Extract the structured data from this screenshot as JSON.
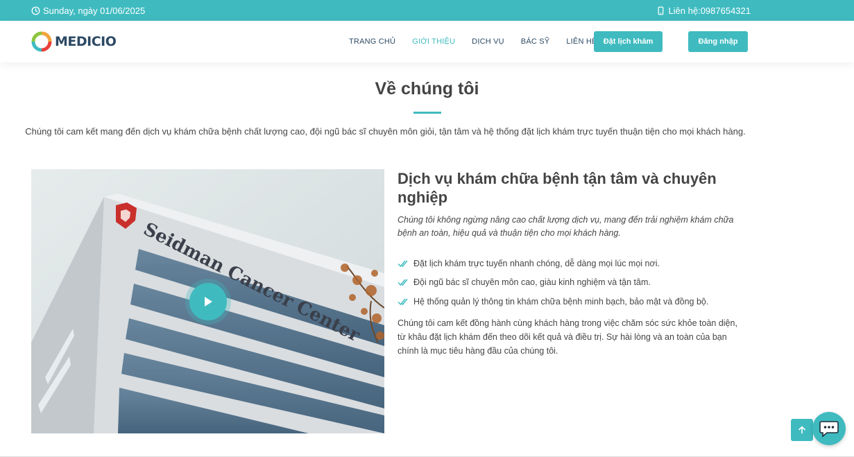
{
  "topbar": {
    "date": "Sunday, ngày 01/06/2025",
    "contact": "Liên hệ:0987654321",
    "date_icon": "clock-icon",
    "contact_icon": "phone-icon"
  },
  "header": {
    "logo_text": "MEDICIO",
    "nav": [
      "TRANG CHỦ",
      "GIỚI THIỆU",
      "DỊCH VỤ",
      "BÁC SỸ",
      "LIÊN HỆ"
    ],
    "active_nav": "GIỚI THIỆU",
    "book_button": "Đặt lịch khám",
    "login_button": "Đăng nhập"
  },
  "about": {
    "title": "Về chúng tôi",
    "intro": "Chúng tôi cam kết mang đến dịch vụ khám chữa bệnh chất lượng cao, đội ngũ bác sĩ chuyên môn giỏi, tận tâm và hệ thống đặt lịch khám trực tuyến thuận tiện cho mọi khách hàng.",
    "heading": "Dịch vụ khám chữa bệnh tận tâm và chuyên nghiệp",
    "lead": "Chúng tôi không ngừng nâng cao chất lượng dịch vụ, mang đến trải nghiệm khám chữa bệnh an toàn, hiệu quả và thuận tiện cho mọi khách hàng.",
    "checklist": [
      "Đặt lịch khám trực tuyến nhanh chóng, dễ dàng mọi lúc mọi nơi.",
      "Đội ngũ bác sĩ chuyên môn cao, giàu kinh nghiệm và tận tâm.",
      "Hệ thống quản lý thông tin khám chữa bệnh minh bạch, bảo mật và đồng bộ."
    ],
    "paragraph": "Chúng tôi cam kết đồng hành cùng khách hàng trong việc chăm sóc sức khỏe toàn diện, từ khâu đặt lịch khám đến theo dõi kết quả và điều trị. Sự hài lòng và an toàn của bạn chính là mục tiêu hàng đầu của chúng tôi.",
    "photo_sign": "Seidman Cancer Center"
  },
  "colors": {
    "accent": "#3fbbc0",
    "heading": "#444444",
    "nav_text": "#2c4964"
  }
}
